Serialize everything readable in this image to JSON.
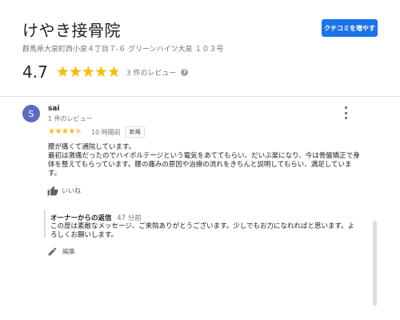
{
  "business": {
    "name": "けやき接骨院",
    "address": "群馬県大泉町西小泉４丁目７-６ グリーンハイツ大泉 １０３号",
    "add_review_label": "クチコミを増やす"
  },
  "summary": {
    "rating": "4.7",
    "rating_value": 4.7,
    "star_glyphs": "★★★★★",
    "review_count_label": "3 件のレビュー",
    "help_icon": "?"
  },
  "review": {
    "avatar_initial": "S",
    "avatar_color": "#5c6bc0",
    "author": "sai",
    "author_meta": "1 件のレビュー",
    "star_glyphs": "★★★★★",
    "rating_value": 4,
    "time": "10 時間前",
    "badge": "新規",
    "body_lines": [
      "腰が痛くて通院しています。",
      "最初は激痛だったのでハイボルテージという電気をあててもらい、だいぶ楽になり、今は骨盤矯正で身",
      "体を整えてもらっています。腰の痛みの原因や治療の流れをきちんと説明してもらい、満足していま",
      "す。"
    ],
    "like_label": "いいね"
  },
  "owner_reply": {
    "title": "オーナーからの返信",
    "time": "47 分前",
    "body_lines": [
      "この度は素敵なメッセージ、ご来院ありがとうございます。少しでもお力になれればと思います。よ",
      "ろしくお願いします。"
    ],
    "edit_label": "編集"
  },
  "colors": {
    "accent": "#1a73e8",
    "star": "#fbbc04",
    "muted": "#70757a"
  },
  "icons": {
    "more": "more-vertical-icon",
    "like": "thumbs-up-icon",
    "edit": "pencil-icon",
    "help": "help-circle-icon"
  }
}
